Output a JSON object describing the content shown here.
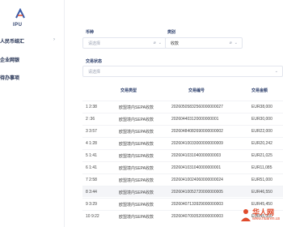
{
  "sidebar": {
    "logo_text": "IPU",
    "items": [
      {
        "label": "人民币结汇"
      },
      {
        "label": "企业网银"
      },
      {
        "label": "待办事项"
      }
    ]
  },
  "filters": {
    "currency": {
      "label": "币种",
      "placeholder": "请选择"
    },
    "category": {
      "label": "类别",
      "value": "收款"
    },
    "status": {
      "label": "交易状态",
      "placeholder": "请选择"
    }
  },
  "table": {
    "headers": {
      "type": "交易类型",
      "no": "交易编号",
      "amount": "交易金额"
    },
    "rows": [
      {
        "idx": "1  2:38",
        "type": "欧盟境内SEPA收款",
        "no": "20260505832560000000027",
        "amount": "EUR38,000"
      },
      {
        "idx": "2  :36",
        "type": "欧盟境内SEPA收款",
        "no": "202604403120000000001",
        "amount": "EUR30,000"
      },
      {
        "idx": "3  3:57",
        "type": "欧盟境内SEPA收款",
        "no": "20260484082690000000002",
        "amount": "EUR22,000"
      },
      {
        "idx": "4  1:28",
        "type": "欧盟境内SEPA收款",
        "no": "20260410033000000000009",
        "amount": "EUR20,242"
      },
      {
        "idx": "5  1:41",
        "type": "欧盟境内SEPA收款",
        "no": "2026041031040000000003",
        "amount": "EUR21,025"
      },
      {
        "idx": "6  1:41",
        "type": "欧盟境内SEPA收款",
        "no": "2026041031040000000001",
        "amount": "EUR11,085"
      },
      {
        "idx": "7  2:58",
        "type": "欧盟境内SEPA收款",
        "no": "20260410024060000000024",
        "amount": "EUR51,000"
      },
      {
        "idx": "8  3:44",
        "type": "欧盟境内SEPA收款",
        "no": "20260410052720000000005",
        "amount": "EUR46,550"
      },
      {
        "idx": "9  3:29",
        "type": "欧盟境内SEPA收款",
        "no": "20260407133929000000003",
        "amount": "EUR45,450"
      },
      {
        "idx": "10  9:22",
        "type": "欧盟境内SEPA收款",
        "no": "20260407093520000000003",
        "amount": "EUR45,000"
      }
    ]
  },
  "watermark": {
    "text": "华人网",
    "url": "www.huaren.us"
  },
  "colors": {
    "brand": "#2c3e6b",
    "accent": "#3a5ba8",
    "watermark": "#e04b2c"
  }
}
